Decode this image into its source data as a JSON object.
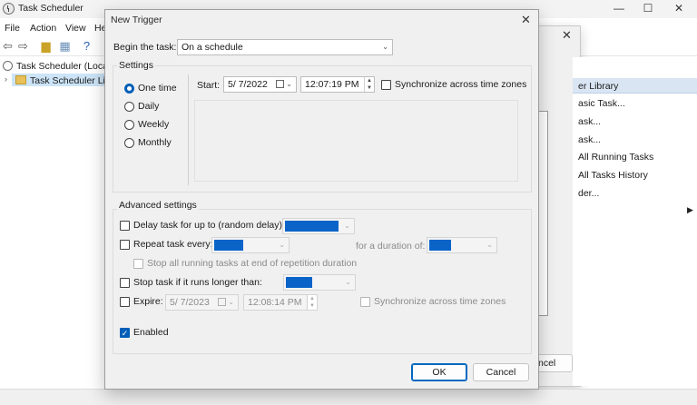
{
  "app": {
    "title": "Task Scheduler",
    "menu": [
      "File",
      "Action",
      "View",
      "He"
    ],
    "tree": [
      "Task Scheduler (Local)",
      "Task Scheduler Libra"
    ],
    "actions": {
      "header": "er Library",
      "items": [
        "asic Task...",
        "ask...",
        "ask...",
        "All Running Tasks",
        "All Tasks History",
        "der..."
      ]
    },
    "create_task": {
      "cancel_label": "ncel"
    }
  },
  "dialog": {
    "title": "New Trigger",
    "begin_task": {
      "label": "Begin the task:",
      "value": "On a schedule"
    },
    "settings": {
      "title": "Settings",
      "radios": [
        "One time",
        "Daily",
        "Weekly",
        "Monthly"
      ],
      "selected": "One time",
      "start_label": "Start:",
      "start_date": "5/  7/2022",
      "start_time": "12:07:19 PM",
      "sync_label": "Synchronize across time zones"
    },
    "advanced": {
      "title": "Advanced settings",
      "delay_label": "Delay task for up to (random delay):",
      "repeat_label": "Repeat task every:",
      "duration_label": "for a duration of:",
      "stop_running_label": "Stop all running tasks at end of repetition duration",
      "stop_longer_label": "Stop task if it runs longer than:",
      "expire_label": "Expire:",
      "expire_date": "5/  7/2023",
      "expire_time": "12:08:14 PM",
      "expire_sync_label": "Synchronize across time zones",
      "enabled_label": "Enabled",
      "enabled": true
    },
    "buttons": {
      "ok": "OK",
      "cancel": "Cancel"
    }
  },
  "colors": {
    "accent": "#005fb8",
    "selection": "#0a64c8",
    "dialog_bg": "#f0f0f0"
  }
}
